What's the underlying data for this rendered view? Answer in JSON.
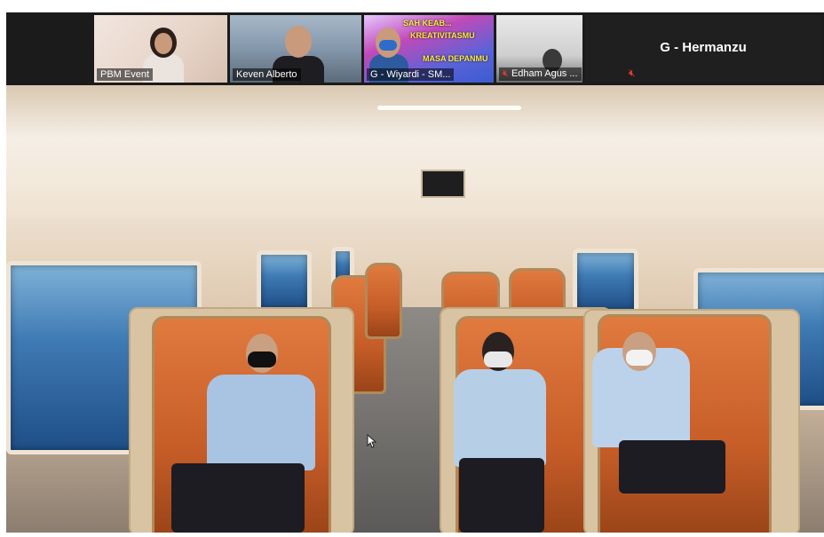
{
  "participants": [
    {
      "name": "PBM Event",
      "muted": false,
      "icon": "webcam-tile"
    },
    {
      "name": "Keven Alberto",
      "muted": false,
      "icon": "webcam-tile"
    },
    {
      "name": "G - Wiyardi - SM...",
      "muted": false,
      "icon": "webcam-tile"
    },
    {
      "name": "Edham Agus ...",
      "muted": true,
      "icon": "microphone-muted-icon"
    }
  ],
  "featured_participant": {
    "name": "G - Hermanzu",
    "muted": true,
    "icon": "microphone-muted-icon"
  },
  "poster_text": [
    "SAH KEAB...",
    "KREATIVITASMU",
    "MASA DEPANMU"
  ],
  "colors": {
    "mute_icon": "#e53935",
    "seat": "#d0652e",
    "strip_bg": "#1b1b1b"
  }
}
